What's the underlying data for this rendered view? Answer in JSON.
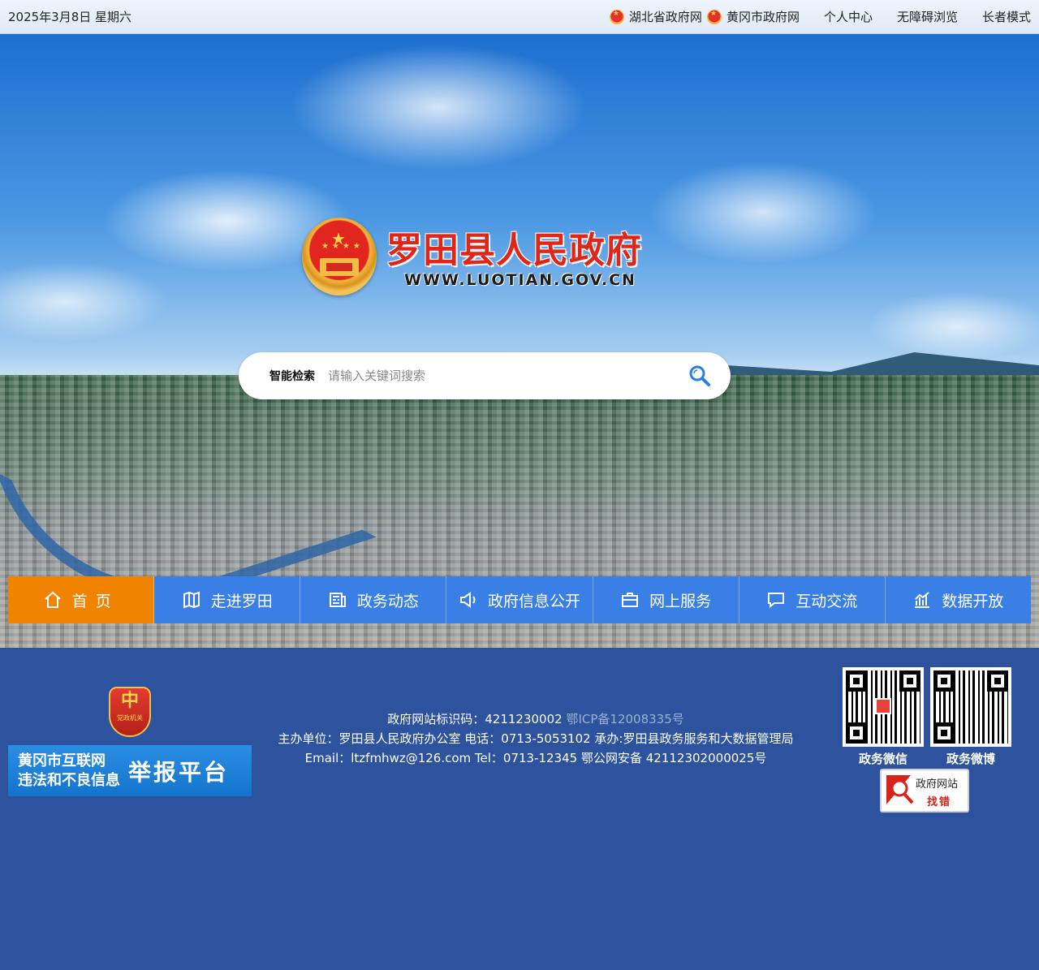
{
  "topbar": {
    "date": "2025年3月8日 星期六",
    "links": [
      {
        "label": "湖北省政府网",
        "emblem": true
      },
      {
        "label": "黄冈市政府网",
        "emblem": true
      },
      {
        "label": "个人中心",
        "emblem": false
      },
      {
        "label": "无障碍浏览",
        "emblem": false
      },
      {
        "label": "长者模式",
        "emblem": false
      }
    ]
  },
  "logo": {
    "title": "罗田县人民政府",
    "url": "WWW.LUOTIAN.GOV.CN"
  },
  "search": {
    "label": "智能检索",
    "placeholder": "请输入关键词搜索",
    "icon": "search-icon"
  },
  "nav": {
    "items": [
      {
        "label": "首页",
        "icon": "home-icon",
        "active": true
      },
      {
        "label": "走进罗田",
        "icon": "map-icon",
        "active": false
      },
      {
        "label": "政务动态",
        "icon": "news-icon",
        "active": false
      },
      {
        "label": "政府信息公开",
        "icon": "speaker-icon",
        "active": false
      },
      {
        "label": "网上服务",
        "icon": "briefcase-icon",
        "active": false
      },
      {
        "label": "互动交流",
        "icon": "chat-icon",
        "active": false
      },
      {
        "label": "数据开放",
        "icon": "chart-icon",
        "active": false
      }
    ]
  },
  "footer": {
    "report": {
      "party_mark": "党政机关",
      "line1": "黄冈市互联网",
      "line2": "违法和不良信息",
      "platform": "举报平台"
    },
    "site_id": "政府网站标识码：4211230002",
    "icp": "鄂ICP备12008335号",
    "sponsor": "主办单位：罗田县人民政府办公室 电话：0713-5053102 承办:罗田县政务服务和大数据管理局",
    "contact": "Email：ltzfmhwz@126.com Tel：0713-12345 鄂公网安备 42112302000025号",
    "qr_codes": [
      {
        "caption": "政务微信"
      },
      {
        "caption": "政务微博"
      }
    ],
    "findbug": {
      "line1": "政府网站",
      "line2": "找错"
    }
  },
  "colors": {
    "nav_blue": "#3a7fe6",
    "nav_active": "#f08400",
    "footer_bg": "#2d539e",
    "title_red": "#e02619"
  }
}
